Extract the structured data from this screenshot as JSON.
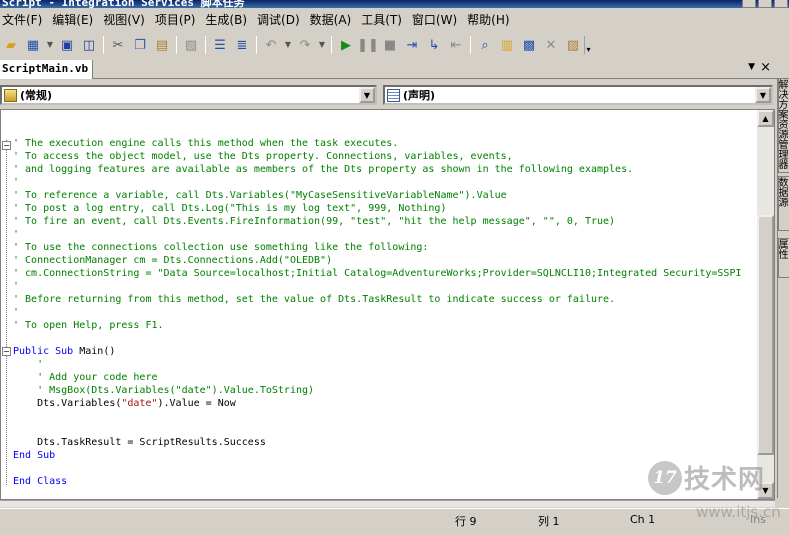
{
  "window": {
    "title": "Script - Integration Services 脚本任务"
  },
  "menu": {
    "items": [
      "文件(F)",
      "编辑(E)",
      "视图(V)",
      "项目(P)",
      "生成(B)",
      "调试(D)",
      "数据(A)",
      "工具(T)",
      "窗口(W)",
      "帮助(H)"
    ]
  },
  "toolbar": {
    "icons": [
      "open-folder",
      "add-item",
      "save",
      "save-all",
      "cut",
      "copy",
      "paste",
      "find",
      "indent",
      "outdent",
      "undo",
      "redo",
      "start",
      "pause",
      "stop",
      "step-into",
      "step-over",
      "step-out",
      "breakpoint",
      "properties",
      "object-browser",
      "toolbox",
      "options"
    ]
  },
  "tab": {
    "label": "ScriptMain.vb",
    "dropdown_glyph": "▼",
    "close_glyph": "×"
  },
  "selectors": {
    "class_name": "(常规)",
    "method_name": "(声明)"
  },
  "code": {
    "lines": [
      [
        {
          "t": "' The execution engine calls this method when the task executes.",
          "c": "comment"
        }
      ],
      [
        {
          "t": "' To access the object model, use the Dts property. Connections, variables, events,",
          "c": "comment"
        }
      ],
      [
        {
          "t": "' and logging features are available as members of the Dts property as shown in the following examples.",
          "c": "comment"
        }
      ],
      [
        {
          "t": "'",
          "c": "comment"
        }
      ],
      [
        {
          "t": "' To reference a variable, call Dts.Variables(\"MyCaseSensitiveVariableName\").Value",
          "c": "comment"
        }
      ],
      [
        {
          "t": "' To post a log entry, call Dts.Log(\"This is my log text\", 999, Nothing)",
          "c": "comment"
        }
      ],
      [
        {
          "t": "' To fire an event, call Dts.Events.FireInformation(99, \"test\", \"hit the help message\", \"\", 0, True)",
          "c": "comment"
        }
      ],
      [
        {
          "t": "'",
          "c": "comment"
        }
      ],
      [
        {
          "t": "' To use the connections collection use something like the following:",
          "c": "comment"
        }
      ],
      [
        {
          "t": "' ConnectionManager cm = Dts.Connections.Add(\"OLEDB\")",
          "c": "comment"
        }
      ],
      [
        {
          "t": "' cm.ConnectionString = \"Data Source=localhost;Initial Catalog=AdventureWorks;Provider=SQLNCLI10;Integrated Security=SSPI",
          "c": "comment"
        }
      ],
      [
        {
          "t": "'",
          "c": "comment"
        }
      ],
      [
        {
          "t": "' Before returning from this method, set the value of Dts.TaskResult to indicate success or failure.",
          "c": "comment"
        }
      ],
      [
        {
          "t": "'",
          "c": "comment"
        }
      ],
      [
        {
          "t": "' To open Help, press F1.",
          "c": "comment"
        }
      ],
      [],
      [
        {
          "t": "Public Sub ",
          "c": "kw"
        },
        {
          "t": "Main()",
          "c": "plain"
        }
      ],
      [
        {
          "t": "    '",
          "c": "comment"
        }
      ],
      [
        {
          "t": "    ' Add your code here",
          "c": "comment"
        }
      ],
      [
        {
          "t": "    ' MsgBox(Dts.Variables(\"date\").Value.ToString)",
          "c": "comment"
        }
      ],
      [
        {
          "t": "    Dts.Variables(",
          "c": "plain"
        },
        {
          "t": "\"date\"",
          "c": "str"
        },
        {
          "t": ").Value = Now",
          "c": "plain"
        }
      ],
      [],
      [],
      [
        {
          "t": "    Dts.TaskResult = ScriptResults.Success",
          "c": "plain"
        }
      ],
      [
        {
          "t": "End Sub",
          "c": "kw"
        }
      ],
      [],
      [
        {
          "t": "End Class",
          "c": "kw"
        }
      ]
    ]
  },
  "status": {
    "line": "行 9",
    "col": "列 1",
    "ch": "Ch 1",
    "mode": "Ins"
  },
  "dock": {
    "tabs": [
      "解决方案资源管理器",
      "数据源",
      "属性"
    ]
  },
  "watermark": {
    "badge": "17",
    "brand": "技术网",
    "url": "www.itjs.cn"
  },
  "colors": {
    "comment": "#008000",
    "keyword": "#0000ff",
    "string": "#a31515"
  }
}
